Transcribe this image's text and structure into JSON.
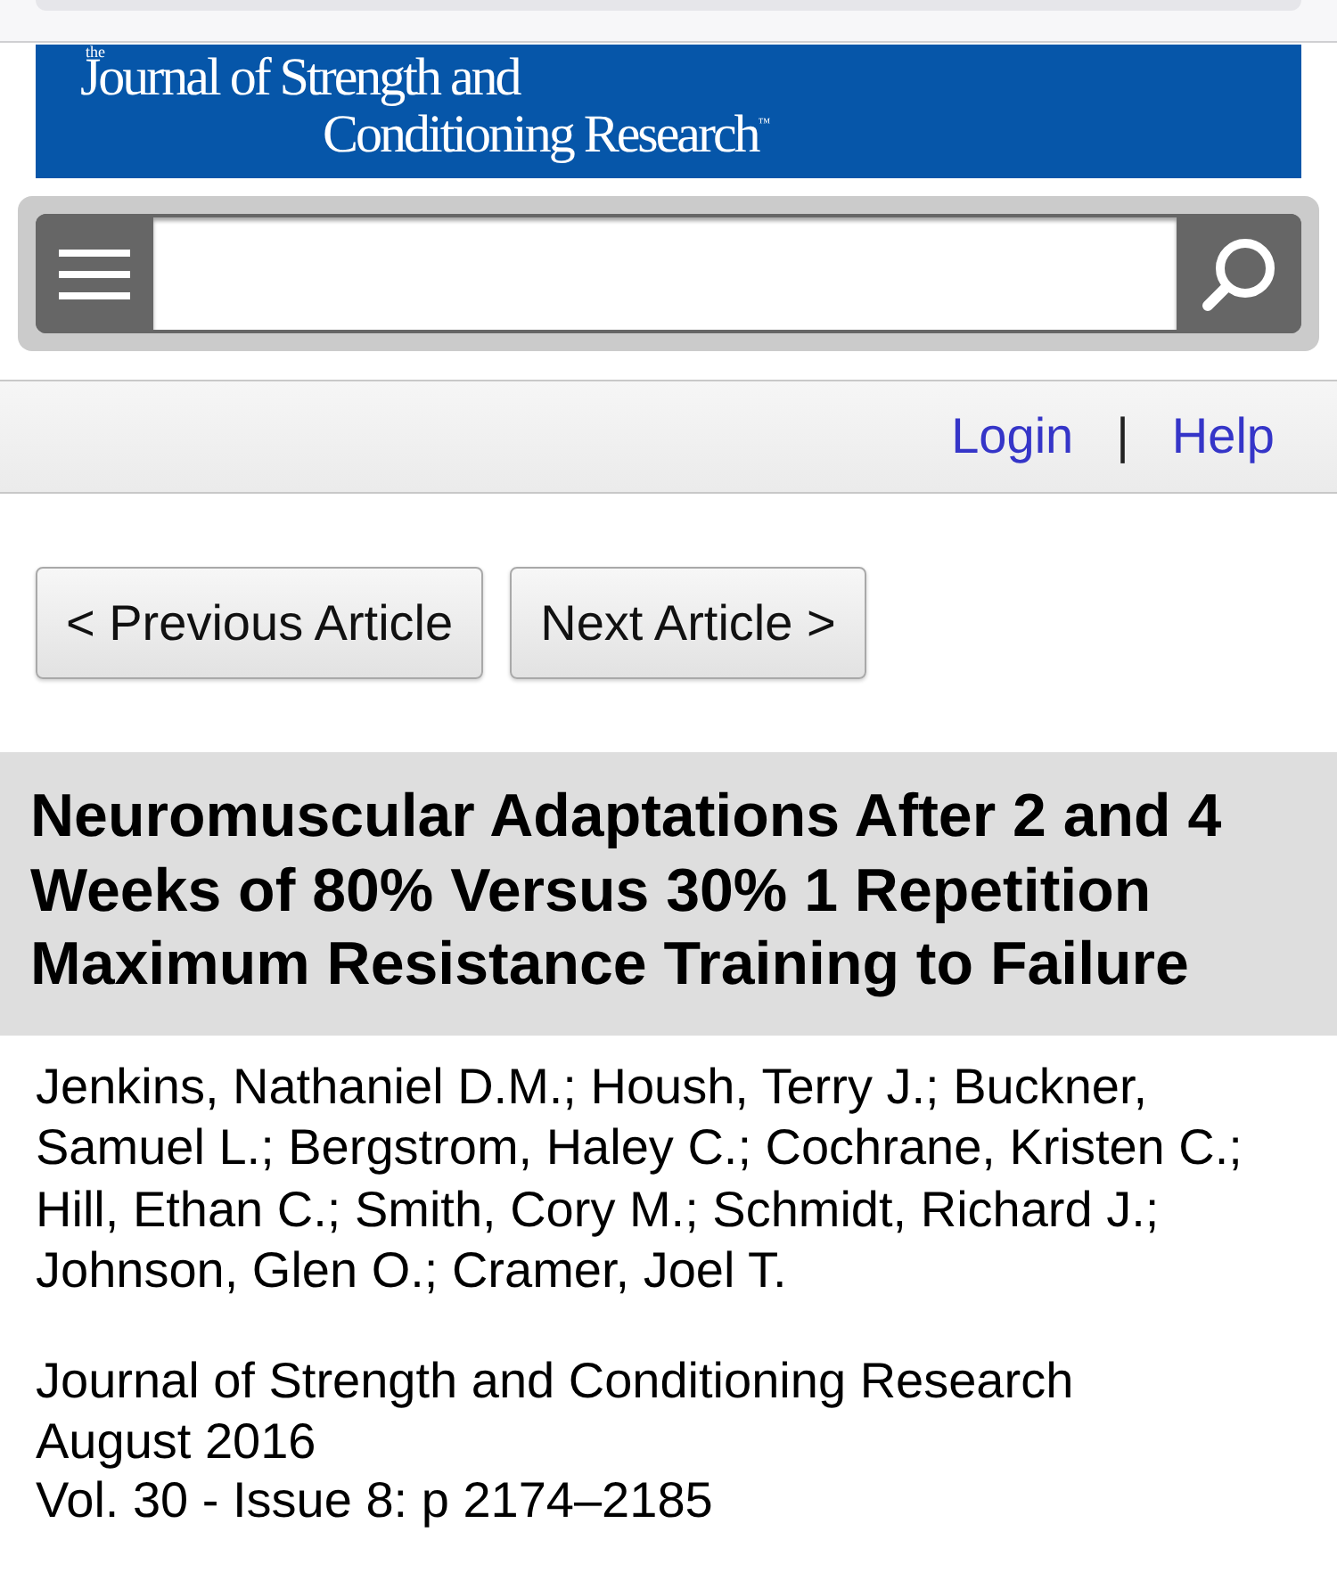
{
  "banner": {
    "logo": {
      "prefix": "the",
      "line_1": "Journal of Strength and",
      "line_2": "Conditioning Research",
      "mark": "™"
    }
  },
  "top_links": {
    "items": [
      {
        "label": "Login"
      },
      {
        "label": "Help"
      }
    ],
    "separator": "|"
  },
  "article_nav": {
    "buttons": [
      {
        "label": "< Previous Article"
      },
      {
        "label": "Next Article >"
      }
    ]
  },
  "article": {
    "title": "Neuromuscular Adaptations After 2 and 4 Weeks of 80% Versus 30% 1 Repetition Maximum Resistance Training to Failure",
    "authors": "Jenkins, Nathaniel D.M.; Housh, Terry J.; Buckner, Samuel L.; Bergstrom, Haley C.; Cochrane, Kristen C.; Hill, Ethan C.; Smith, Cory M.; Schmidt, Richard J.; Johnson, Glen O.; Cramer, Joel T.",
    "journal": "Journal of Strength and Conditioning Research",
    "date": "August 2016",
    "citation": "Vol. 30 - Issue 8: p 2174–2185"
  }
}
